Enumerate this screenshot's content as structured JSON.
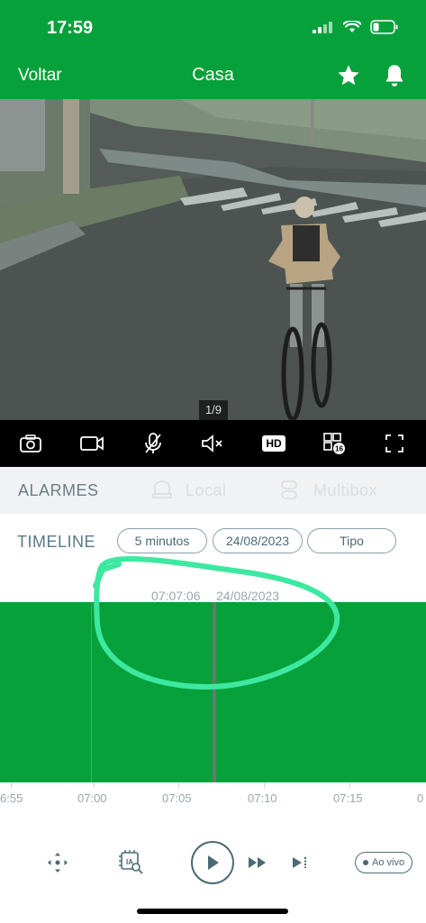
{
  "status_bar": {
    "time": "17:59"
  },
  "nav": {
    "back_label": "Voltar",
    "title": "Casa",
    "star_icon": "star-icon",
    "bell_icon": "bell-icon"
  },
  "video": {
    "page_indicator": "1/9"
  },
  "toolbar": {
    "hd_label": "HD",
    "grid_badge": "16"
  },
  "tabs": {
    "alarms": "ALARMES",
    "local": "Local",
    "multibox": "Multibox"
  },
  "timeline": {
    "label": "TIMELINE",
    "interval": "5 minutos",
    "date": "24/08/2023",
    "type": "Tipo",
    "cursor_time": "07:07:06",
    "cursor_date": "24/08/2023",
    "axis_labels": [
      "6:55",
      "07:00",
      "07:05",
      "07:10",
      "07:15",
      "0"
    ]
  },
  "controls": {
    "live_label": "Ao vivo"
  },
  "colors": {
    "brand_green": "#06a13a",
    "annotation": "#3de8a0",
    "text_muted": "#577986"
  }
}
